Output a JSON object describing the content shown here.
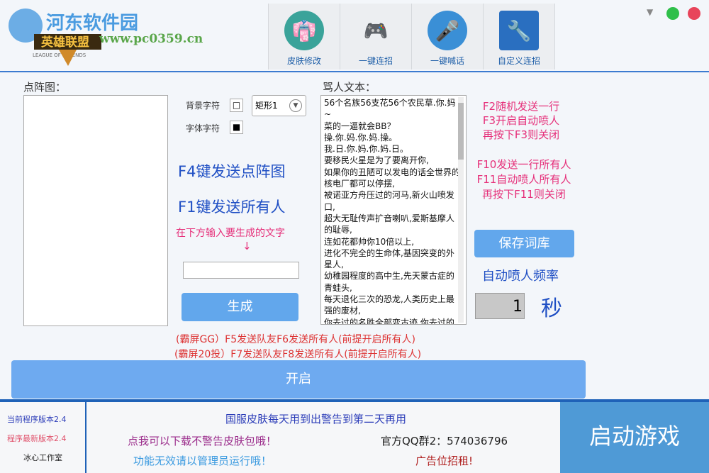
{
  "logo": {
    "text": "LEAGUE OF LEGENDS",
    "title": "英雄联盟",
    "watermark": "河东软件园",
    "watermark_url": "www.pc0359.cn"
  },
  "nav": [
    {
      "label": "皮肤修改",
      "icon": "jacket-icon"
    },
    {
      "label": "一键连招",
      "icon": "gamepad-icon"
    },
    {
      "label": "一键喊话",
      "icon": "microphone-icon"
    },
    {
      "label": "自定义连招",
      "icon": "wrench-icon"
    }
  ],
  "window_controls": {
    "menu": "▼",
    "colors": {
      "minimize": "#2fbf4a",
      "close": "#e8445a"
    }
  },
  "left": {
    "matrix_label": "点阵图：",
    "bg_char_label": "背景字符",
    "bg_char": "□",
    "font_char_label": "字体字符",
    "font_char": "■",
    "shape_select": "矩形1",
    "f4": "F4键发送点阵图",
    "f1": "F1键发送所有人",
    "input_hint": "在下方输入要生成的文字",
    "arrow": "↓",
    "input_value": "",
    "generate": "生成"
  },
  "text": {
    "label": "骂人文本：",
    "content": "56个名族56支花56个农民草.你.妈~\n菜的一逼就会BB？\n操.你.妈.你.妈.操。\n我.日.你.妈.你.妈.日。\n要移民火星是为了要离开你,\n如果你的丑陋可以发电的话全世界的核电厂都可以停摆,\n被诺亚方舟压过的河马,新火山喷发口,\n超大无耻传声扩音喇叭,爱斯基摩人的耻辱,\n连如花都帅你10倍以上,\n进化不完全的生命体,基因突变的外星人,\n幼稚园程度的高中生,先天蒙古症的青蛙头,\n每天退化三次的恐龙,人类历史上最强的废材,\n你去过的名胜全部变古迹,你去过的方法全变成历史"
  },
  "right": {
    "lines1": [
      "F2随机发送一行",
      "F3开启自动喷人",
      "再按下F3则关闭"
    ],
    "lines2": [
      "F10发送一行所有人",
      "F11自动喷人所有人",
      "再按下F11则关闭"
    ],
    "save": "保存词库",
    "freq_label": "自动喷人频率",
    "freq_value": "1",
    "unit": "秒"
  },
  "hints": [
    "(霸屏GG）F5发送队友F6发送所有人(前提开启所有人)",
    "(霸屏20投）F7发送队友F8发送所有人(前提开启所有人)"
  ],
  "start": "开启",
  "footer": {
    "version": "当前程序版本2.4",
    "latest": "程序最新版本2.4",
    "studio": "冰心工作室",
    "notice": "国服皮肤每天用到出警告到第二天再用",
    "download": "点我可以下载不警告皮肤包哦！",
    "qq": "官方QQ群2：574036796",
    "admin": "功能无效请以管理员运行哦！",
    "ad": "广告位招租!",
    "launch": "启动游戏"
  }
}
